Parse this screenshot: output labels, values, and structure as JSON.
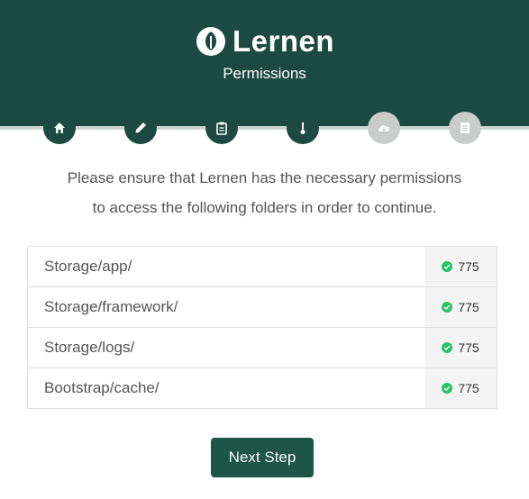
{
  "app": {
    "brand": "Lernen",
    "page_title": "Permissions"
  },
  "colors": {
    "primary": "#1d4a40",
    "inactive_step": "#c9cccb",
    "success": "#27c26a",
    "button": "#1d5546"
  },
  "steps": [
    {
      "icon": "home-icon",
      "state": "complete"
    },
    {
      "icon": "pencil-icon",
      "state": "complete"
    },
    {
      "icon": "clipboard-icon",
      "state": "complete"
    },
    {
      "icon": "thermometer-icon",
      "state": "current"
    },
    {
      "icon": "cloud-download-icon",
      "state": "pending"
    },
    {
      "icon": "document-icon",
      "state": "pending"
    }
  ],
  "message": {
    "line1": "Please ensure that Lernen has the necessary permissions",
    "line2": "to access the following folders in order to continue."
  },
  "permissions": [
    {
      "path": "Storage/app/",
      "value": "775",
      "status": "ok"
    },
    {
      "path": "Storage/framework/",
      "value": "775",
      "status": "ok"
    },
    {
      "path": "Storage/logs/",
      "value": "775",
      "status": "ok"
    },
    {
      "path": "Bootstrap/cache/",
      "value": "775",
      "status": "ok"
    }
  ],
  "actions": {
    "next_label": "Next Step"
  }
}
